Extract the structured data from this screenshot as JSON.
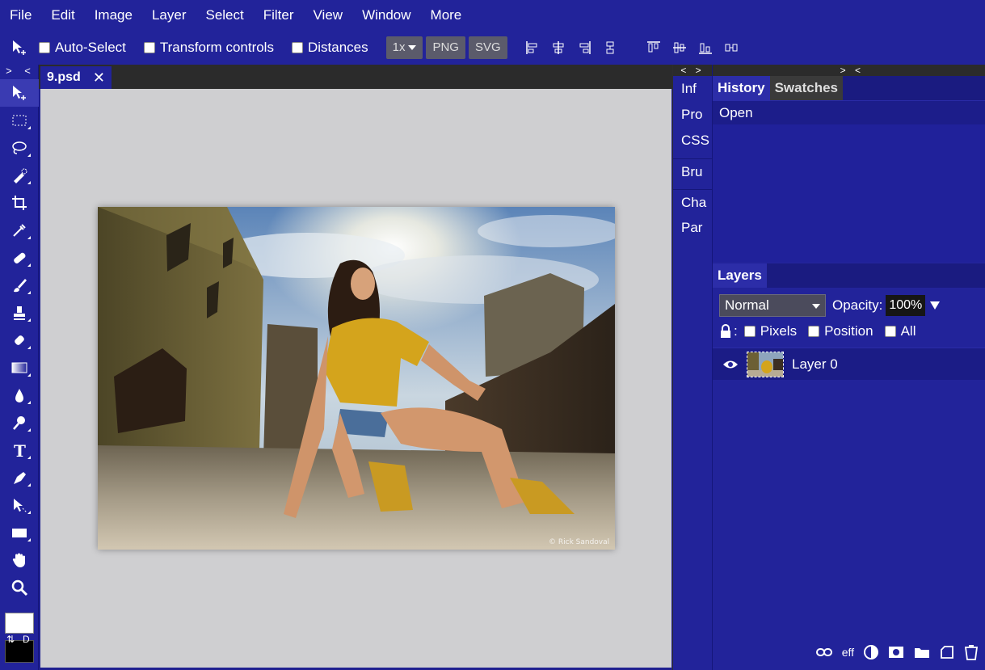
{
  "menu": [
    "File",
    "Edit",
    "Image",
    "Layer",
    "Select",
    "Filter",
    "View",
    "Window",
    "More"
  ],
  "options": {
    "auto_select": "Auto-Select",
    "transform_controls": "Transform controls",
    "distances": "Distances",
    "scale": "1x",
    "png": "PNG",
    "svg": "SVG"
  },
  "toolbar": {
    "collapse": "> <",
    "swap": "⇅",
    "default": "D"
  },
  "document": {
    "tab_name": "9.psd",
    "close": "✕"
  },
  "mini_panel": {
    "header": "< >",
    "items": [
      "Inf",
      "Pro",
      "CSS",
      "Bru",
      "Cha",
      "Par"
    ]
  },
  "right": {
    "header": "> <",
    "tabs": [
      "History",
      "Swatches"
    ],
    "history_items": [
      "Open"
    ],
    "layers_tab": "Layers",
    "blend_mode": "Normal",
    "opacity_label": "Opacity:",
    "opacity_value": "100%",
    "lock_colon": ":",
    "lock_pixels": "Pixels",
    "lock_position": "Position",
    "lock_all": "All",
    "layer_name": "Layer 0",
    "footer_eff": "eff"
  },
  "photo": {
    "watermark": "© Rick Sandoval"
  }
}
